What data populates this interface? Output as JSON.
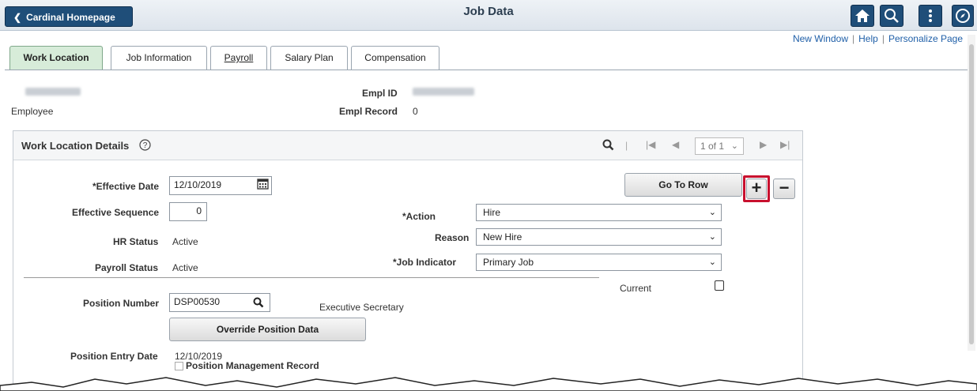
{
  "header": {
    "back_label": "Cardinal Homepage",
    "title": "Job Data",
    "icons": [
      "home-icon",
      "search-icon",
      "actions-menu-icon",
      "navbar-compass-icon"
    ]
  },
  "links": {
    "new_window": "New Window",
    "help": "Help",
    "personalize": "Personalize Page",
    "sep": "|"
  },
  "tabs": [
    {
      "label": "Work Location",
      "active": true
    },
    {
      "label": "Job Information",
      "active": false
    },
    {
      "label": "Payroll",
      "active": false
    },
    {
      "label": "Salary Plan",
      "active": false
    },
    {
      "label": "Compensation",
      "active": false
    }
  ],
  "employee": {
    "type_label": "Employee",
    "empl_id_label": "Empl ID",
    "empl_record_label": "Empl Record",
    "empl_record_value": "0"
  },
  "section": {
    "title": "Work Location Details",
    "pager": "1 of 1",
    "sep": "|"
  },
  "form": {
    "effective_date_label": "*Effective Date",
    "effective_date_value": "12/10/2019",
    "effective_sequence_label": "Effective Sequence",
    "effective_sequence_value": "0",
    "hr_status_label": "HR Status",
    "hr_status_value": "Active",
    "payroll_status_label": "Payroll Status",
    "payroll_status_value": "Active",
    "action_label": "*Action",
    "action_value": "Hire",
    "reason_label": "Reason",
    "reason_value": "New Hire",
    "job_indicator_label": "*Job Indicator",
    "job_indicator_value": "Primary Job",
    "current_label": "Current",
    "position_number_label": "Position Number",
    "position_number_value": "DSP00530",
    "position_description": "Executive Secretary",
    "override_button": "Override Position Data",
    "position_entry_date_label": "Position Entry Date",
    "position_entry_date_value": "12/10/2019",
    "position_mgmt_label": "Position Management Record"
  },
  "buttons": {
    "go_to_row": "Go To Row",
    "add_row": "+",
    "delete_row": "−"
  },
  "colors": {
    "header_button": "#1f4e79",
    "active_tab": "#d7ecd9",
    "highlight": "#c8102e"
  }
}
